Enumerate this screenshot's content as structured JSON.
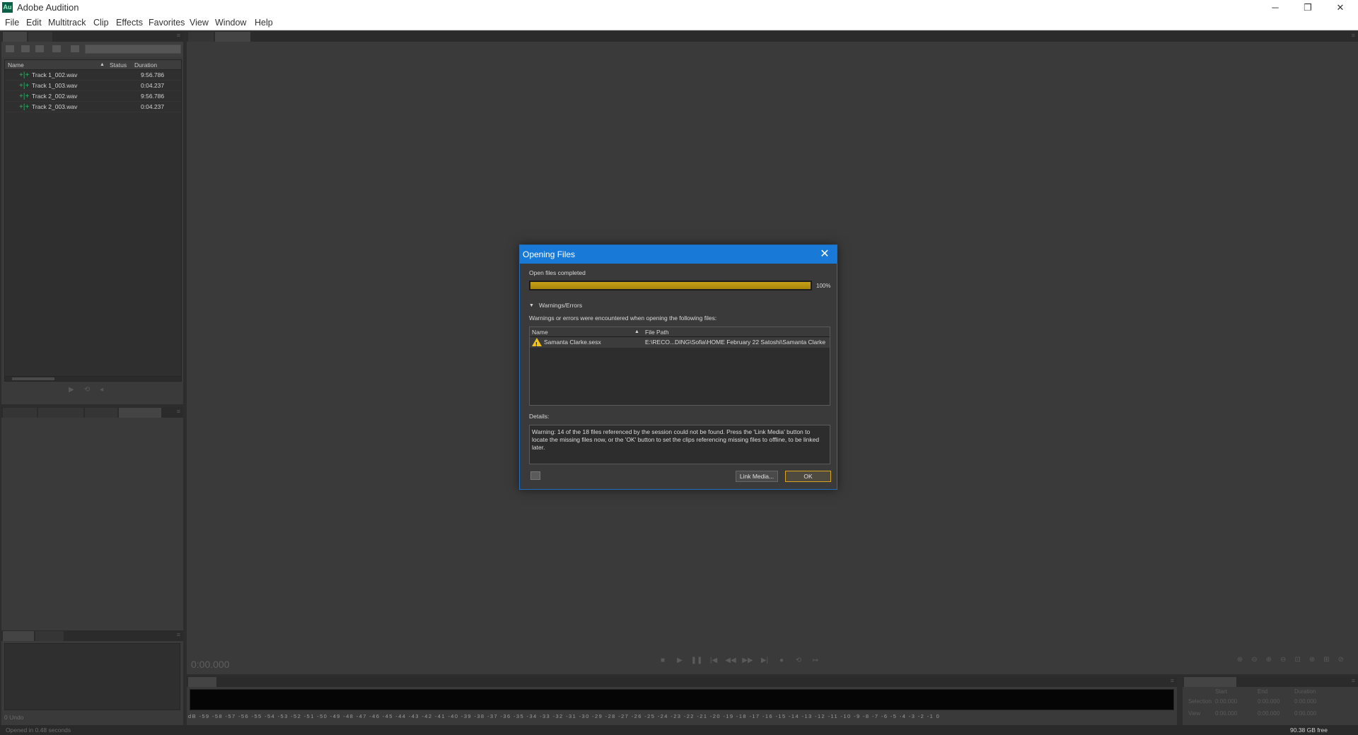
{
  "window": {
    "title": "Adobe Audition",
    "logo_text": "Au",
    "controls": {
      "minimize": "─",
      "restore": "❐",
      "close": "✕"
    }
  },
  "menu": [
    "File",
    "Edit",
    "Multitrack",
    "Clip",
    "Effects",
    "Favorites",
    "View",
    "Window",
    "Help"
  ],
  "files_panel": {
    "columns": {
      "name": "Name",
      "status": "Status",
      "duration": "Duration"
    },
    "files": [
      {
        "name": "Track 1_002.wav",
        "duration": "9:56.786"
      },
      {
        "name": "Track 1_003.wav",
        "duration": "0:04.237"
      },
      {
        "name": "Track 2_002.wav",
        "duration": "9:56.786"
      },
      {
        "name": "Track 2_003.wav",
        "duration": "0:04.237"
      }
    ]
  },
  "history_panel": {
    "undo_count": "0 Undo"
  },
  "editor": {
    "time": "0:00.000"
  },
  "levels": {
    "scale": "dB -59 -58 -57 -56 -55 -54 -53 -52 -51 -50 -49 -48 -47 -46 -45 -44 -43 -42 -41 -40 -39 -38 -37 -36 -35 -34 -33 -32 -31 -30 -29 -28 -27 -26 -25 -24 -23 -22 -21 -20 -19 -18 -17 -16 -15 -14 -13 -12 -11 -10 -9 -8 -7 -6 -5 -4 -3 -2 -1 0"
  },
  "selection_view": {
    "cols": {
      "start": "Start",
      "end": "End",
      "duration": "Duration"
    },
    "selection": {
      "label": "Selection",
      "start": "0:00.000",
      "end": "0:00.000",
      "duration": "0:00.000"
    },
    "view": {
      "label": "View",
      "start": "0:00.000",
      "end": "0:00.000",
      "duration": "0:00.000"
    }
  },
  "statusbar": {
    "left": "Opened in 0.48 seconds",
    "right": "90.38 GB free"
  },
  "dialog": {
    "title": "Opening Files",
    "status": "Open files completed",
    "progress": 100,
    "progress_label": "100%",
    "section_title": "Warnings/Errors",
    "section_desc": "Warnings or errors were encountered when opening the following files:",
    "columns": {
      "name": "Name",
      "path": "File Path"
    },
    "rows": [
      {
        "name": "Samanta Clarke.sesx",
        "path": "E:\\RECO...DING\\Sofia\\HOME February 22 Satoshi\\Samanta Clarke"
      }
    ],
    "details_label": "Details:",
    "details": "Warning: 14 of the 18 files referenced by the session could not be found. Press the 'Link Media' button to locate the missing files now, or the 'OK' button to set the clips referencing missing files to offline, to be linked later.",
    "buttons": {
      "link_media": "Link Media...",
      "ok": "OK"
    }
  },
  "colors": {
    "accent": "#1879d7",
    "progress": "#c7a016",
    "wave_icon": "#2fb16a",
    "warning": "#f2c318"
  }
}
